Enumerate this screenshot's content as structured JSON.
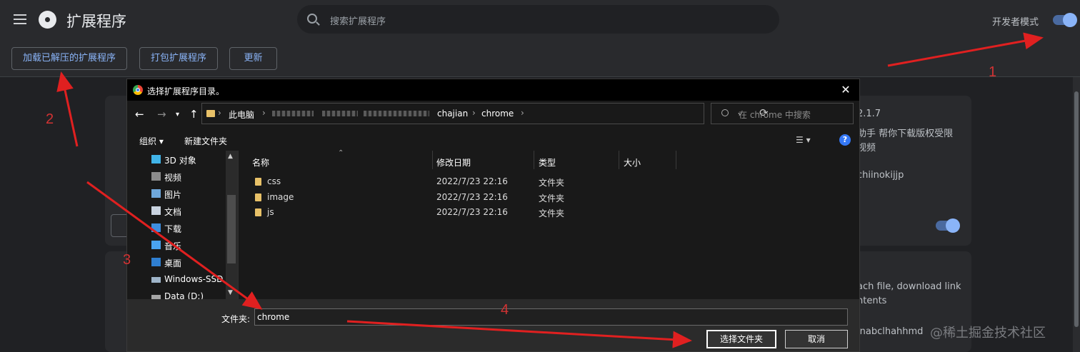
{
  "header": {
    "title": "扩展程序",
    "search_placeholder": "搜索扩展程序",
    "dev_mode_label": "开发者模式",
    "dev_mode_on": true
  },
  "toolbar": {
    "load_unpacked": "加载已解压的扩展程序",
    "pack": "打包扩展程序",
    "update": "更新"
  },
  "cards": {
    "card1_version": "2.1.7",
    "card1_desc_line1": "助手 帮你下载版权受限",
    "card1_desc_line2": "视频",
    "card1_id": "chiinokijjp",
    "card2_desc_line1": "ach file, download link",
    "card2_desc_line2": "ntents",
    "card2_id": "jnabclhahhmd"
  },
  "dialog": {
    "title": "选择扩展程序目录。",
    "close_glyph": "✕",
    "breadcrumb": [
      "此电脑",
      "chajian",
      "chrome"
    ],
    "search_placeholder": "在 chrome 中搜索",
    "organize": "组织 ▾",
    "new_folder": "新建文件夹",
    "help": "?",
    "nav_tree": [
      {
        "label": "3D 对象",
        "icon": "3d-objects-icon"
      },
      {
        "label": "视频",
        "icon": "video-icon"
      },
      {
        "label": "图片",
        "icon": "pictures-icon"
      },
      {
        "label": "文档",
        "icon": "documents-icon"
      },
      {
        "label": "下载",
        "icon": "downloads-icon"
      },
      {
        "label": "音乐",
        "icon": "music-icon"
      },
      {
        "label": "桌面",
        "icon": "desktop-icon"
      },
      {
        "label": "Windows-SSD (",
        "icon": "drive-icon"
      },
      {
        "label": "Data (D:)",
        "icon": "drive-icon"
      }
    ],
    "columns": {
      "name": "名称",
      "modified": "修改日期",
      "type": "类型",
      "size": "大小"
    },
    "files": [
      {
        "name": "css",
        "modified": "2022/7/23 22:16",
        "type": "文件夹"
      },
      {
        "name": "image",
        "modified": "2022/7/23 22:16",
        "type": "文件夹"
      },
      {
        "name": "js",
        "modified": "2022/7/23 22:16",
        "type": "文件夹"
      }
    ],
    "folder_label": "文件夹:",
    "folder_value": "chrome",
    "select_button": "选择文件夹",
    "cancel_button": "取消"
  },
  "annotations": {
    "n1": "1",
    "n2": "2",
    "n3": "3",
    "n4": "4",
    "arrow_color": "#e02020"
  },
  "watermark": "@稀土掘金技术社区"
}
